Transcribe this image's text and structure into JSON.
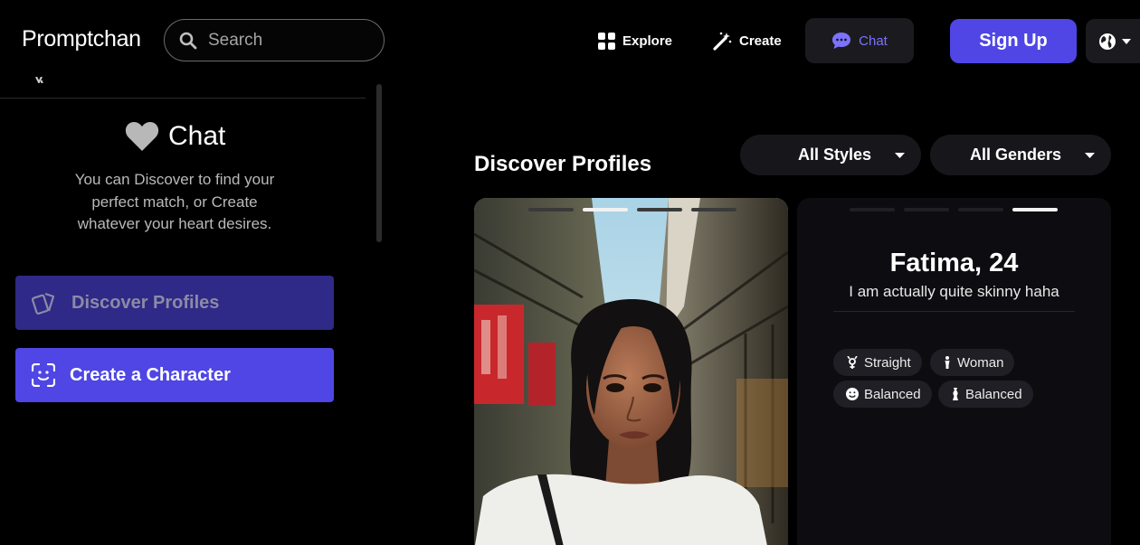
{
  "app": {
    "logo": "Promptchan"
  },
  "search": {
    "placeholder": "Search"
  },
  "nav": {
    "explore": "Explore",
    "create": "Create",
    "chat": "Chat",
    "signup": "Sign Up"
  },
  "sidebar": {
    "chat_title": "Chat",
    "intro": "You can Discover to find your perfect match, or Create whatever your heart desires.",
    "discover_label": "Discover Profiles",
    "create_label": "Create a Character"
  },
  "main": {
    "title": "Discover Profiles",
    "filters": {
      "styles": "All Styles",
      "genders": "All Genders"
    }
  },
  "profile": {
    "name": "Fatima, 24",
    "bio": "I am actually quite skinny haha",
    "tags": [
      "Straight",
      "Woman",
      "Balanced",
      "Balanced"
    ],
    "photo_count": 4,
    "active_photo_photo_card": 2,
    "active_photo_info_card": 4
  },
  "colors": {
    "accent": "#4f46e5",
    "chat_text": "#7c72ff",
    "card_bg": "#0d0d11"
  }
}
